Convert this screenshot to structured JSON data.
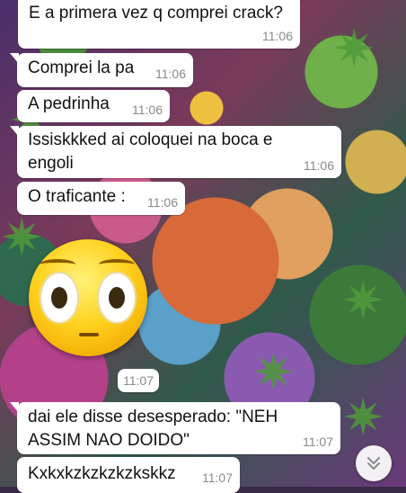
{
  "chat": {
    "messages": [
      {
        "text": "E a primera vez q comprei crack?",
        "time": "11:06"
      },
      {
        "text": "Comprei la pa",
        "time": "11:06"
      },
      {
        "text": "A pedrinha",
        "time": "11:06"
      },
      {
        "text": "Issiskkked ai coloquei na boca e\nengoli",
        "time": "11:06"
      },
      {
        "text": "O traficante :",
        "time": "11:06"
      },
      {
        "text": "",
        "time": "11:07"
      },
      {
        "text": "dai ele disse desesperado: \"NEH\nASSIM NAO DOIDO\"",
        "time": "11:07"
      },
      {
        "text": "Kxkxkzkzkzkzkskkz",
        "time": "11:07"
      }
    ],
    "sticker": {
      "icon": "flushed-face-icon"
    },
    "scroll_button": {
      "icon": "double-chevron-down-icon"
    }
  }
}
